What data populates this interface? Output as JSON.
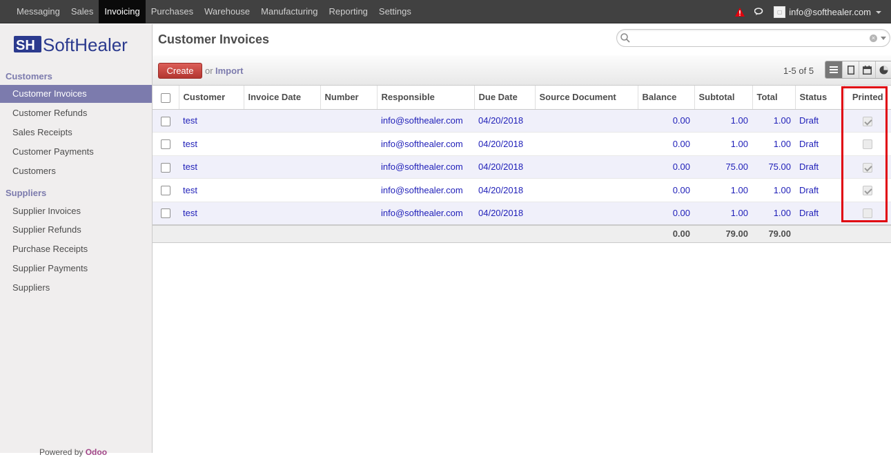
{
  "topbar": {
    "menu": [
      "Messaging",
      "Sales",
      "Invoicing",
      "Purchases",
      "Warehouse",
      "Manufacturing",
      "Reporting",
      "Settings"
    ],
    "active": "Invoicing",
    "user_email": "info@softhealer.com"
  },
  "sidebar": {
    "logo_text": "SoftHealer",
    "sections": [
      {
        "title": "Customers",
        "items": [
          "Customer Invoices",
          "Customer Refunds",
          "Sales Receipts",
          "Customer Payments",
          "Customers"
        ]
      },
      {
        "title": "Suppliers",
        "items": [
          "Supplier Invoices",
          "Supplier Refunds",
          "Purchase Receipts",
          "Supplier Payments",
          "Suppliers"
        ]
      }
    ],
    "active_item": "Customer Invoices",
    "powered_by": "Powered by",
    "powered_brand": "Odoo"
  },
  "main": {
    "title": "Customer Invoices",
    "create_label": "Create",
    "or_label": "or",
    "import_label": "Import",
    "pager": "1-5 of 5"
  },
  "table": {
    "columns": [
      "Customer",
      "Invoice Date",
      "Number",
      "Responsible",
      "Due Date",
      "Source Document",
      "Balance",
      "Subtotal",
      "Total",
      "Status",
      "Printed"
    ],
    "rows": [
      {
        "customer": "test",
        "invoice_date": "",
        "number": "",
        "responsible": "info@softhealer.com",
        "due_date": "04/20/2018",
        "source": "",
        "balance": "0.00",
        "subtotal": "1.00",
        "total": "1.00",
        "status": "Draft",
        "printed": true
      },
      {
        "customer": "test",
        "invoice_date": "",
        "number": "",
        "responsible": "info@softhealer.com",
        "due_date": "04/20/2018",
        "source": "",
        "balance": "0.00",
        "subtotal": "1.00",
        "total": "1.00",
        "status": "Draft",
        "printed": false
      },
      {
        "customer": "test",
        "invoice_date": "",
        "number": "",
        "responsible": "info@softhealer.com",
        "due_date": "04/20/2018",
        "source": "",
        "balance": "0.00",
        "subtotal": "75.00",
        "total": "75.00",
        "status": "Draft",
        "printed": true
      },
      {
        "customer": "test",
        "invoice_date": "",
        "number": "",
        "responsible": "info@softhealer.com",
        "due_date": "04/20/2018",
        "source": "",
        "balance": "0.00",
        "subtotal": "1.00",
        "total": "1.00",
        "status": "Draft",
        "printed": true
      },
      {
        "customer": "test",
        "invoice_date": "",
        "number": "",
        "responsible": "info@softhealer.com",
        "due_date": "04/20/2018",
        "source": "",
        "balance": "0.00",
        "subtotal": "1.00",
        "total": "1.00",
        "status": "Draft",
        "printed": false
      }
    ],
    "totals": {
      "balance": "0.00",
      "subtotal": "79.00",
      "total": "79.00"
    }
  },
  "colors": {
    "accent": "#7c7bad",
    "topbar": "#414141",
    "create": "#c9413b",
    "highlight": "#e0000d"
  }
}
